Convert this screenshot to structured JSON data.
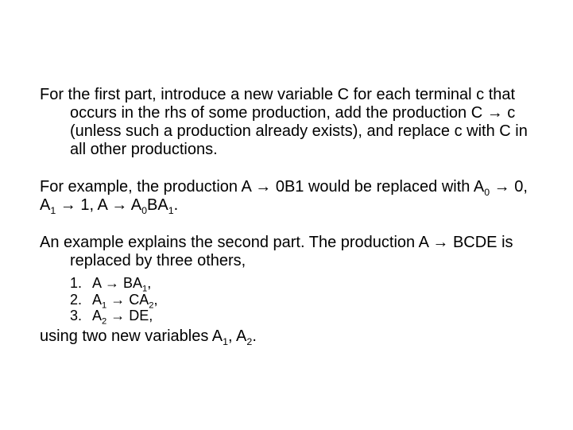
{
  "p1": "For the first part, introduce a new variable C for each terminal c that occurs in the rhs of some production, add the production C → c (unless such a production already exists), and replace c with C in all other productions.",
  "p2a": "For example, the production A → 0B1 would be replaced with A",
  "s0a": "0",
  "p2b": " → 0, A",
  "s1a": "1",
  "p2c": " → 1, A → A",
  "s0b": "0",
  "p2d": "BA",
  "s1b": "1",
  "p2e": ".",
  "p3": "An example explains the second part. The production A → BCDE is replaced by three others,",
  "l1n": "1.",
  "l1a": "A → BA",
  "l1s": "1",
  "l1b": ",",
  "l2n": "2.",
  "l2a": "A",
  "l2s1": "1",
  "l2b": " → CA",
  "l2s2": "2",
  "l2c": ",",
  "l3n": "3.",
  "l3a": "A",
  "l3s1": "2",
  "l3b": " → DE,",
  "p4a": "using two new variables A",
  "s4a": "1",
  "p4b": ", A",
  "s4b": "2",
  "p4c": "."
}
